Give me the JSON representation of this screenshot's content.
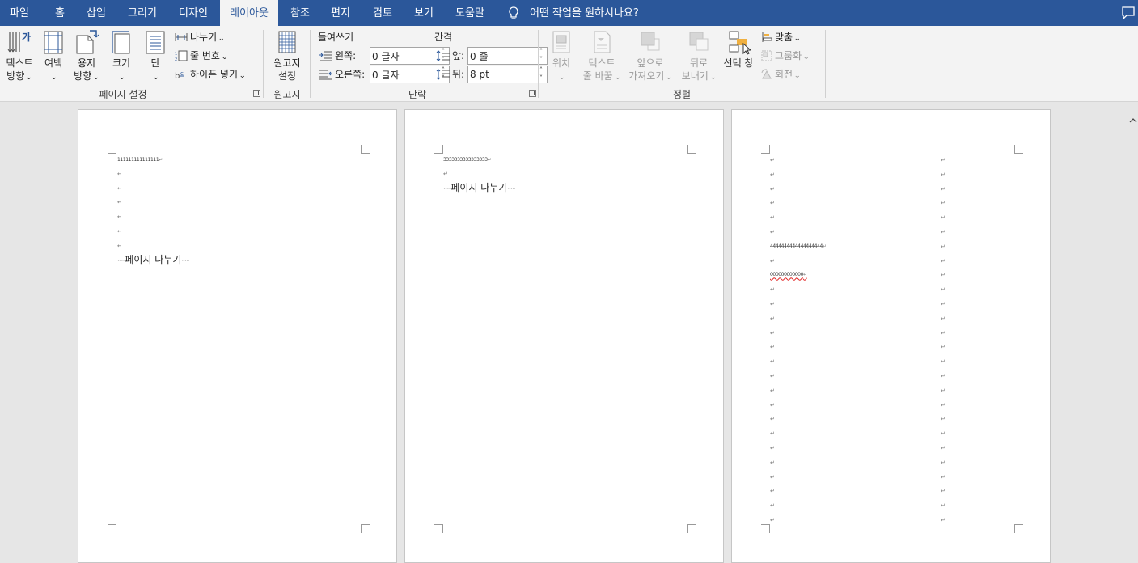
{
  "tabs": [
    {
      "label": "파일",
      "active": false
    },
    {
      "label": "홈",
      "active": false
    },
    {
      "label": "삽입",
      "active": false
    },
    {
      "label": "그리기",
      "active": false
    },
    {
      "label": "디자인",
      "active": false
    },
    {
      "label": "레이아웃",
      "active": true
    },
    {
      "label": "참조",
      "active": false
    },
    {
      "label": "편지",
      "active": false
    },
    {
      "label": "검토",
      "active": false
    },
    {
      "label": "보기",
      "active": false
    },
    {
      "label": "도움말",
      "active": false
    }
  ],
  "tell_me": "어떤 작업을 원하시나요?",
  "ribbon": {
    "page_setup": {
      "label": "페이지 설정",
      "text_direction": {
        "line1": "텍스트",
        "line2": "방향"
      },
      "margins": "여백",
      "orientation": {
        "line1": "용지",
        "line2": "방향"
      },
      "size": "크기",
      "columns": "단",
      "breaks": "나누기",
      "line_numbers": "줄 번호",
      "hyphenation": "하이픈 넣기"
    },
    "manuscript": {
      "label": "원고지",
      "settings": {
        "line1": "원고지",
        "line2": "설정"
      }
    },
    "paragraph": {
      "label": "단락",
      "indent_label": "들여쓰기",
      "spacing_label": "간격",
      "left_label": "왼쪽:",
      "right_label": "오른쪽:",
      "before_label": "앞:",
      "after_label": "뒤:",
      "left_value": "0 글자",
      "right_value": "0 글자",
      "before_value": "0 줄",
      "after_value": "8 pt"
    },
    "arrange": {
      "label": "정렬",
      "position": "위치",
      "wrap_text": {
        "line1": "텍스트",
        "line2": "줄 바꿈"
      },
      "bring_forward": {
        "line1": "앞으로",
        "line2": "가져오기"
      },
      "send_backward": {
        "line1": "뒤로",
        "line2": "보내기"
      },
      "selection_pane": "선택 창",
      "align": "맞춤",
      "group": "그룹화",
      "rotate": "회전"
    }
  },
  "document": {
    "page_break_label": "페이지 나누기",
    "paragraph_mark": "↵",
    "page1": {
      "first_line": "111111111111111"
    },
    "page2": {
      "first_line": "3333333333333333"
    },
    "page3": {
      "text_a": "4444444444444444444",
      "text_b": "000000000000"
    }
  }
}
